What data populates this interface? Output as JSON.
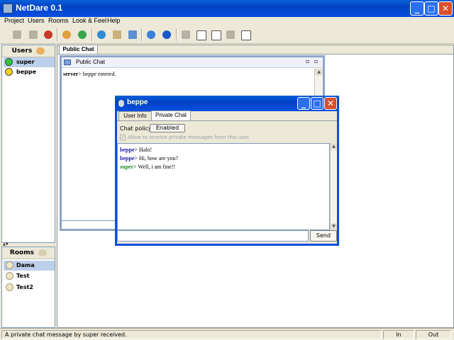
{
  "window": {
    "title": "NetDare 0.1",
    "min": "_",
    "max": "□",
    "close": "✕"
  },
  "menu": [
    {
      "label": "Project"
    },
    {
      "label": "Users"
    },
    {
      "label": "Rooms"
    },
    {
      "label": "Look & Feel"
    },
    {
      "label": "Help"
    }
  ],
  "toolbar": {
    "icons": [
      "disconnect-icon",
      "delete-icon",
      "remove-user-icon",
      "user-icon",
      "users-icon",
      "globe-icon",
      "clipboard-icon",
      "image-icon",
      "network-icon",
      "info-icon",
      "window-icon-1",
      "window-icon-2",
      "window-icon-3",
      "window-icon-4",
      "window-icon-5"
    ]
  },
  "users": {
    "header": "Users",
    "items": [
      {
        "name": "super",
        "color": "#27c93f"
      },
      {
        "name": "beppe",
        "color": "#f2d21c"
      }
    ]
  },
  "rooms": {
    "header": "Rooms",
    "items": [
      {
        "name": "Dama"
      },
      {
        "name": "Test"
      },
      {
        "name": "Test2"
      }
    ]
  },
  "main_tab": "Public Chat",
  "public_chat": {
    "title": "Public Chat",
    "message": {
      "user": "server",
      "text": "beppe entered."
    }
  },
  "private_window": {
    "title": "beppe",
    "tabs": [
      "User Info",
      "Private Chat"
    ],
    "chat_policy_label": "Chat policy:",
    "chat_policy_value": "Enabled",
    "allow_label": "Allow to receive private messages from this user.",
    "messages": [
      {
        "user": "beppe",
        "text": "Halo!",
        "color": "#1a1aa8"
      },
      {
        "user": "beppe",
        "text": "Hi, how are you?",
        "color": "#1a1aa8"
      },
      {
        "user": "super",
        "text": "Well, i am fine!!",
        "color": "#1b8f1b"
      }
    ],
    "send_label": "Send",
    "input_value": ""
  },
  "status": {
    "message": "A private chat message by super received.",
    "in": "In",
    "out": "Out"
  }
}
